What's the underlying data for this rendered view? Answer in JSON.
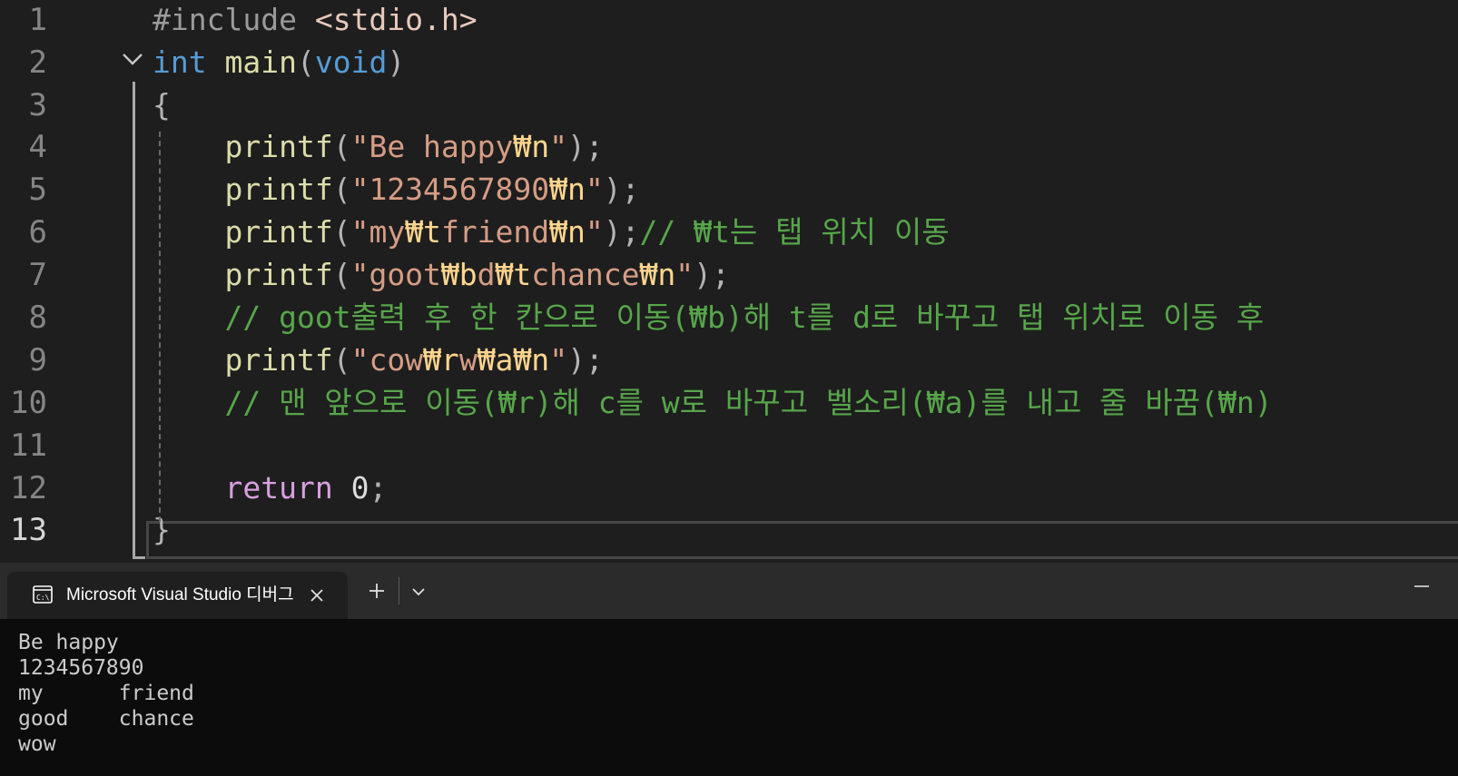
{
  "editor": {
    "lines": [
      {
        "n": "1",
        "indent": "",
        "tokens": [
          {
            "t": "#include",
            "c": "pre"
          },
          {
            "t": " ",
            "c": ""
          },
          {
            "t": "<stdio.h>",
            "c": "inc"
          }
        ]
      },
      {
        "n": "2",
        "indent": "",
        "tokens": [
          {
            "t": "int",
            "c": "kw"
          },
          {
            "t": " ",
            "c": ""
          },
          {
            "t": "main",
            "c": "fn"
          },
          {
            "t": "(",
            "c": "punc"
          },
          {
            "t": "void",
            "c": "kw"
          },
          {
            "t": ")",
            "c": "punc"
          }
        ]
      },
      {
        "n": "3",
        "indent": "",
        "tokens": [
          {
            "t": "{",
            "c": "punc"
          }
        ]
      },
      {
        "n": "4",
        "indent": "    ",
        "tokens": [
          {
            "t": "printf",
            "c": "fn"
          },
          {
            "t": "(",
            "c": "punc"
          },
          {
            "t": "\"Be happy",
            "c": "str"
          },
          {
            "t": "₩n",
            "c": "esc"
          },
          {
            "t": "\"",
            "c": "str"
          },
          {
            "t": ");",
            "c": "punc"
          }
        ]
      },
      {
        "n": "5",
        "indent": "    ",
        "tokens": [
          {
            "t": "printf",
            "c": "fn"
          },
          {
            "t": "(",
            "c": "punc"
          },
          {
            "t": "\"1234567890",
            "c": "str"
          },
          {
            "t": "₩n",
            "c": "esc"
          },
          {
            "t": "\"",
            "c": "str"
          },
          {
            "t": ");",
            "c": "punc"
          }
        ]
      },
      {
        "n": "6",
        "indent": "    ",
        "tokens": [
          {
            "t": "printf",
            "c": "fn"
          },
          {
            "t": "(",
            "c": "punc"
          },
          {
            "t": "\"my",
            "c": "str"
          },
          {
            "t": "₩t",
            "c": "esc"
          },
          {
            "t": "friend",
            "c": "str"
          },
          {
            "t": "₩n",
            "c": "esc"
          },
          {
            "t": "\"",
            "c": "str"
          },
          {
            "t": ");",
            "c": "punc"
          },
          {
            "t": "// ₩t는 탭 위치 이동",
            "c": "com"
          }
        ]
      },
      {
        "n": "7",
        "indent": "    ",
        "tokens": [
          {
            "t": "printf",
            "c": "fn"
          },
          {
            "t": "(",
            "c": "punc"
          },
          {
            "t": "\"goot",
            "c": "str"
          },
          {
            "t": "₩b",
            "c": "esc"
          },
          {
            "t": "d",
            "c": "str"
          },
          {
            "t": "₩t",
            "c": "esc"
          },
          {
            "t": "chance",
            "c": "str"
          },
          {
            "t": "₩n",
            "c": "esc"
          },
          {
            "t": "\"",
            "c": "str"
          },
          {
            "t": ");",
            "c": "punc"
          }
        ]
      },
      {
        "n": "8",
        "indent": "    ",
        "tokens": [
          {
            "t": "// goot출력 후 한 칸으로 이동(₩b)해 t를 d로 바꾸고 탭 위치로 이동 후",
            "c": "com"
          }
        ]
      },
      {
        "n": "9",
        "indent": "    ",
        "tokens": [
          {
            "t": "printf",
            "c": "fn"
          },
          {
            "t": "(",
            "c": "punc"
          },
          {
            "t": "\"cow",
            "c": "str"
          },
          {
            "t": "₩r",
            "c": "esc"
          },
          {
            "t": "w",
            "c": "str"
          },
          {
            "t": "₩a",
            "c": "esc"
          },
          {
            "t": "₩n",
            "c": "esc"
          },
          {
            "t": "\"",
            "c": "str"
          },
          {
            "t": ");",
            "c": "punc"
          }
        ]
      },
      {
        "n": "10",
        "indent": "    ",
        "tokens": [
          {
            "t": "// 맨 앞으로 이동(₩r)해 c를 w로 바꾸고 벨소리(₩a)를 내고 줄 바꿈(₩n)",
            "c": "com"
          }
        ]
      },
      {
        "n": "11",
        "indent": "",
        "tokens": []
      },
      {
        "n": "12",
        "indent": "    ",
        "tokens": [
          {
            "t": "return",
            "c": "ctl"
          },
          {
            "t": " 0",
            "c": ""
          },
          {
            "t": ";",
            "c": "punc"
          }
        ]
      },
      {
        "n": "13",
        "indent": "",
        "tokens": [
          {
            "t": "}",
            "c": "punc"
          }
        ],
        "current": true
      }
    ]
  },
  "terminal": {
    "tab_title": "Microsoft Visual Studio 디버그",
    "tab_icon": "console-icon",
    "output_lines": [
      "Be happy",
      "1234567890",
      "my      friend",
      "good    chance",
      "wow"
    ]
  }
}
